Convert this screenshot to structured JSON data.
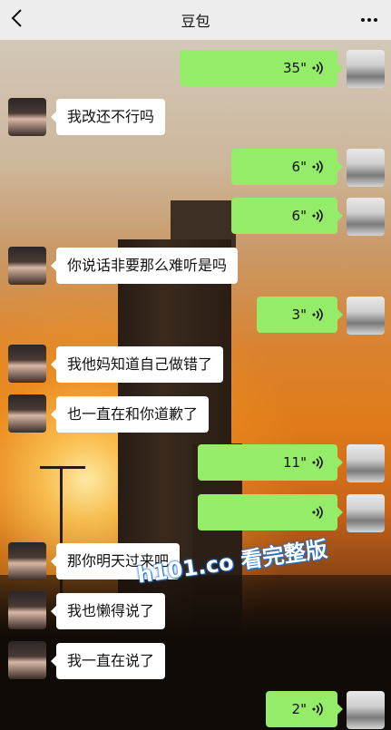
{
  "header": {
    "title": "豆包"
  },
  "messages": [
    {
      "side": "right",
      "type": "voice",
      "duration": "35\""
    },
    {
      "side": "left",
      "type": "text",
      "text": "我改还不行吗"
    },
    {
      "side": "right",
      "type": "voice",
      "duration": "6\""
    },
    {
      "side": "right",
      "type": "voice",
      "duration": "6\""
    },
    {
      "side": "left",
      "type": "text",
      "text": "你说话非要那么难听是吗"
    },
    {
      "side": "right",
      "type": "voice",
      "duration": "3\""
    },
    {
      "side": "left",
      "type": "text",
      "text": "我他妈知道自己做错了"
    },
    {
      "side": "left",
      "type": "text",
      "text": "也一直在和你道歉了"
    },
    {
      "side": "right",
      "type": "voice",
      "duration": "11\""
    },
    {
      "side": "right",
      "type": "voice",
      "duration": ""
    },
    {
      "side": "left",
      "type": "text",
      "text": "那你明天过来吧"
    },
    {
      "side": "left",
      "type": "text",
      "text": "我也懒得说了"
    },
    {
      "side": "left",
      "type": "text",
      "text": "我一直在说了"
    },
    {
      "side": "right",
      "type": "voice",
      "duration": "2\""
    }
  ],
  "watermark": {
    "text": "h101.co 看完整版"
  },
  "colors": {
    "outgoing_bubble": "#95ec69",
    "incoming_bubble": "#ffffff",
    "topbar": "#ededed"
  },
  "icons": {
    "back": "chevron-left-icon",
    "more": "more-dots-icon",
    "voice": "voice-wave-icon"
  }
}
